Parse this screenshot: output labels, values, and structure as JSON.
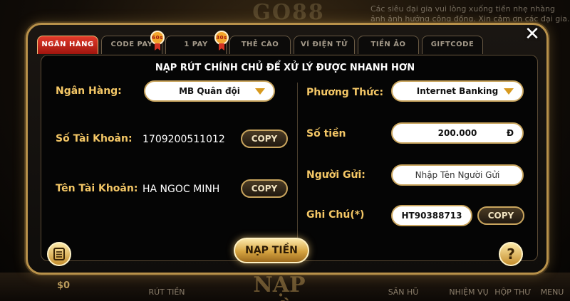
{
  "background": {
    "logo_text": "GO88",
    "marquee": "Các siêu đại gia vui lòng xuống tiền nhẹ nhàng ảnh ảnh hưởng công đồng. Xin cảm ơn các đại gia.",
    "balance": "$0",
    "bottom_menu": [
      "RÚT TIỀN",
      "SĂN HŨ",
      "NHIỆM VỤ",
      "HỘP THƯ",
      "MENU"
    ],
    "bottom_center": "NẠP TIỀN"
  },
  "tabs": [
    {
      "label": "NGÂN HÀNG",
      "active": true,
      "badge": ""
    },
    {
      "label": "CODE PAY",
      "active": false,
      "badge": "60s"
    },
    {
      "label": "1 PAY",
      "active": false,
      "badge": "30s"
    },
    {
      "label": "THẺ CÀO",
      "active": false,
      "badge": ""
    },
    {
      "label": "VÍ ĐIỆN TỬ",
      "active": false,
      "badge": ""
    },
    {
      "label": "TIỀN ẢO",
      "active": false,
      "badge": ""
    },
    {
      "label": "GIFTCODE",
      "active": false,
      "badge": ""
    }
  ],
  "headline": "NẠP RÚT CHÍNH CHỦ ĐỂ XỬ LÝ ĐƯỢC NHANH HƠN",
  "left": {
    "bank_label": "Ngân Hàng:",
    "bank_value": "MB Quân đội",
    "account_number_label": "Số Tài Khoản:",
    "account_number_value": "1709200511012",
    "account_name_label": "Tên Tài Khoản:",
    "account_name_value": "HA NGOC MINH",
    "copy_label": "COPY"
  },
  "right": {
    "method_label": "Phương Thức:",
    "method_value": "Internet Banking",
    "amount_label": "Số tiền",
    "amount_value": "200.000",
    "amount_unit": "Đ",
    "sender_label": "Người Gửi:",
    "sender_placeholder": "Nhập Tên Người Gửi",
    "note_label": "Ghi Chú(*)",
    "note_value": "HT90388713",
    "copy_label": "COPY"
  },
  "deposit_button": "NẠP TIỀN",
  "help_icon": "?",
  "close_icon": "✕",
  "icons": {
    "history": "history-icon",
    "help": "help-icon",
    "close": "close-icon",
    "dropdown": "chevron-down-icon"
  }
}
